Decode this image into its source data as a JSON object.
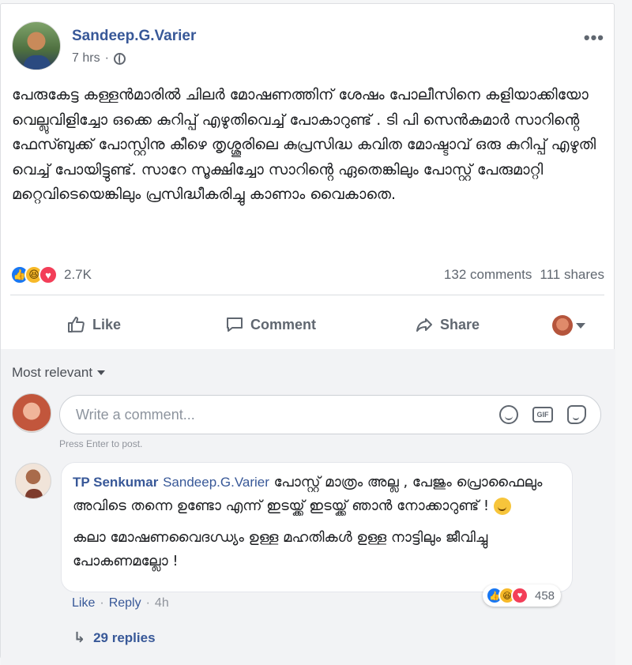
{
  "post": {
    "author": "Sandeep.G.Varier",
    "time": "7 hrs",
    "privacy_icon": "globe-icon",
    "more_label": "•••",
    "text": "പേരുകേട്ട കള്ളൻമാരിൽ ചിലർ മോഷണത്തിന് ശേഷം പോലീസിനെ കളിയാക്കിയോ വെല്ലുവിളിച്ചോ ഒക്കെ കുറിപ്പ് എഴുതിവെച്ച് പോകാറുണ്ട് . ടി പി സെൻകുമാർ സാറിൻ്റെ ഫേസ്ബുക്ക് പോസ്റ്റിനു കീഴെ തൃശ്ശൂരിലെ കുപ്രസിദ്ധ കവിത മോഷ്ടാവ് ഒരു കുറിപ്പ് എഴുതി വെച്ച് പോയിട്ടുണ്ട്. സാറേ സൂക്ഷിച്ചോ സാറിൻ്റെ ഏതെങ്കിലും പോസ്റ്റ് പേരുമാറ്റി മറ്റെവിടെയെങ്കിലും പ്രസിദ്ധീകരിച്ചു കാണാം വൈകാതെ.",
    "reaction_count": "2.7K",
    "comments": "132 comments",
    "shares": "111 shares"
  },
  "actions": {
    "like": "Like",
    "comment": "Comment",
    "share": "Share"
  },
  "comments_section": {
    "sort_label": "Most relevant",
    "input_placeholder": "Write a comment...",
    "press_enter": "Press Enter to post.",
    "gif_label": "GIF"
  },
  "top_comment": {
    "author": "TP Senkumar",
    "tag": "Sandeep.G.Varier",
    "text1": "പോസ്റ്റ് മാത്രം അല്ല , പേജും പ്രൊഫൈലും അവിടെ തന്നെ ഉണ്ടോ എന്ന് ഇടയ്ക്ക് ഇടയ്ക്ക് ഞാൻ നോക്കാറുണ്ട് !",
    "text2": "കലാ മോഷണവൈദഗ്ധ്യം ഉള്ള മഹതികൾ ഉള്ള നാട്ടിലും ജീവിച്ചു പോകണമല്ലോ !",
    "reaction_count": "458",
    "like": "Like",
    "reply": "Reply",
    "time": "4h",
    "replies": "29 replies"
  },
  "colors": {
    "link": "#385898",
    "like_blue": "#1877f2",
    "haha_yellow": "#f7b928",
    "love_red": "#f33e58"
  }
}
